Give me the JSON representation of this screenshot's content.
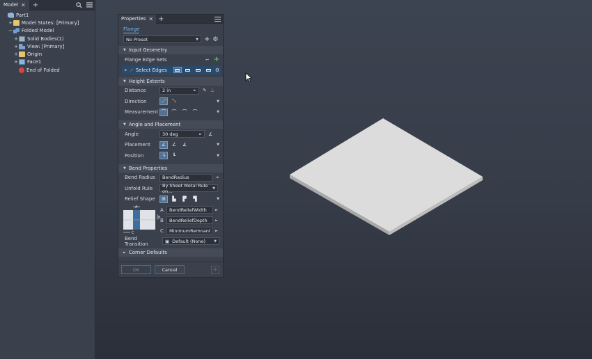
{
  "browser": {
    "tab_label": "Model",
    "tree": [
      {
        "label": "Part1",
        "icon": "part-icon",
        "indent": 0,
        "exp": ""
      },
      {
        "label": "Model States: [Primary]",
        "icon": "folder-icon",
        "indent": 1,
        "exp": "+"
      },
      {
        "label": "Folded Model",
        "icon": "folded-model-icon",
        "indent": 1,
        "exp": "−"
      },
      {
        "label": "Solid Bodies(1)",
        "icon": "solid-bodies-icon",
        "indent": 2,
        "exp": "+"
      },
      {
        "label": "View: [Primary]",
        "icon": "view-icon",
        "indent": 2,
        "exp": "+"
      },
      {
        "label": "Origin",
        "icon": "folder-icon",
        "indent": 2,
        "exp": "+"
      },
      {
        "label": "Face1",
        "icon": "face-icon",
        "indent": 2,
        "exp": "+"
      },
      {
        "label": "End of Folded",
        "icon": "end-of-part-icon",
        "indent": 2,
        "exp": ""
      }
    ]
  },
  "props": {
    "tab_label": "Properties",
    "sub_tab": "Flange",
    "preset": "No Preset",
    "input_geometry": {
      "title": "Input Geometry",
      "edge_sets_label": "Flange Edge Sets",
      "select_label": "Select Edges"
    },
    "height_extents": {
      "title": "Height Extents",
      "distance_label": "Distance",
      "distance_value": "2 in",
      "direction_label": "Direction",
      "measurement_label": "Measurement"
    },
    "angle_placement": {
      "title": "Angle and Placement",
      "angle_label": "Angle",
      "angle_value": "30 deg",
      "placement_label": "Placement",
      "position_label": "Position"
    },
    "bend_properties": {
      "title": "Bend Properties",
      "bend_radius_label": "Bend Radius",
      "bend_radius_value": "BendRadius",
      "unfold_rule_label": "Unfold Rule",
      "unfold_rule_value": "By Sheet Metal Rule on...",
      "relief_shape_label": "Relief Shape",
      "relief_a_letter": "A",
      "relief_a_value": "BendReliefWidth",
      "relief_b_letter": "B",
      "relief_b_value": "BendReliefDepth",
      "relief_c_letter": "C",
      "relief_c_value": "MinimumRemnant",
      "diagram_a": "A",
      "diagram_b": "B",
      "diagram_c": "C",
      "bend_transition_label": "Bend Transition",
      "bend_transition_value": "Default (None)"
    },
    "corner_defaults": {
      "title": "Corner Defaults"
    },
    "ok_label": "OK",
    "cancel_label": "Cancel"
  },
  "colors": {
    "accent": "#79b4ea",
    "selection_row": "#2a4a6c",
    "plate_top": "#dcdcdc",
    "plate_side": "#a9a9a9"
  }
}
